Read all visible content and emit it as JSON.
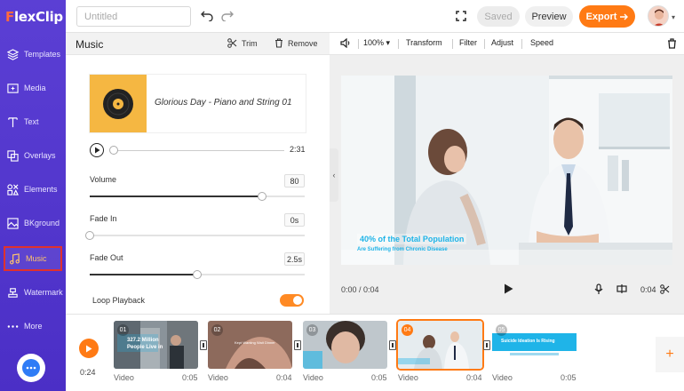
{
  "app": {
    "logo_prefix": "F",
    "logo_rest": "lexClip",
    "brand_color": "#5b3fd4",
    "accent_color": "#ff7a14"
  },
  "sidebar": {
    "items": [
      {
        "label": "Templates",
        "icon": "layers-icon"
      },
      {
        "label": "Media",
        "icon": "media-icon"
      },
      {
        "label": "Text",
        "icon": "text-icon"
      },
      {
        "label": "Overlays",
        "icon": "overlays-icon"
      },
      {
        "label": "Elements",
        "icon": "elements-icon"
      },
      {
        "label": "BKground",
        "icon": "background-icon"
      },
      {
        "label": "Music",
        "icon": "music-note-icon",
        "active": true
      },
      {
        "label": "Watermark",
        "icon": "watermark-icon"
      },
      {
        "label": "More",
        "icon": "more-dots-icon"
      }
    ]
  },
  "topbar": {
    "title_placeholder": "Untitled",
    "saved_label": "Saved",
    "preview_label": "Preview",
    "export_label": "Export"
  },
  "music_panel": {
    "title": "Music",
    "trim_label": "Trim",
    "remove_label": "Remove",
    "song_name": "Glorious Day - Piano and String 01",
    "duration": "2:31",
    "volume_label": "Volume",
    "volume_value": "80",
    "volume_fraction": 0.8,
    "fade_in_label": "Fade In",
    "fade_in_value": "0s",
    "fade_in_fraction": 0.0,
    "fade_out_label": "Fade Out",
    "fade_out_value": "2.5s",
    "fade_out_fraction": 0.5,
    "loop_label": "Loop Playback",
    "loop_on": true
  },
  "preview": {
    "zoom": "100%",
    "tools": [
      "Transform",
      "Filter",
      "Adjust",
      "Speed"
    ],
    "caption_line1": "40% of the Total Population",
    "caption_line2": "Are Suffering from Chronic Disease",
    "current_time": "0:00 / 0:04",
    "clip_duration": "0:04"
  },
  "timeline": {
    "current_time": "0:24",
    "clips": [
      {
        "num": "01",
        "type": "Video",
        "duration": "0:05",
        "caption": "327.2 Million",
        "caption2": "People Live in"
      },
      {
        "num": "02",
        "type": "Video",
        "duration": "0:04",
        "caption": "Kept Wanting Wait Dinner"
      },
      {
        "num": "03",
        "type": "Video",
        "duration": "0:05",
        "caption": ""
      },
      {
        "num": "04",
        "type": "Video",
        "duration": "0:04",
        "caption": "",
        "selected": true
      },
      {
        "num": "05",
        "type": "Video",
        "duration": "0:05",
        "caption": "Suicide Ideation Is Rising"
      }
    ]
  }
}
